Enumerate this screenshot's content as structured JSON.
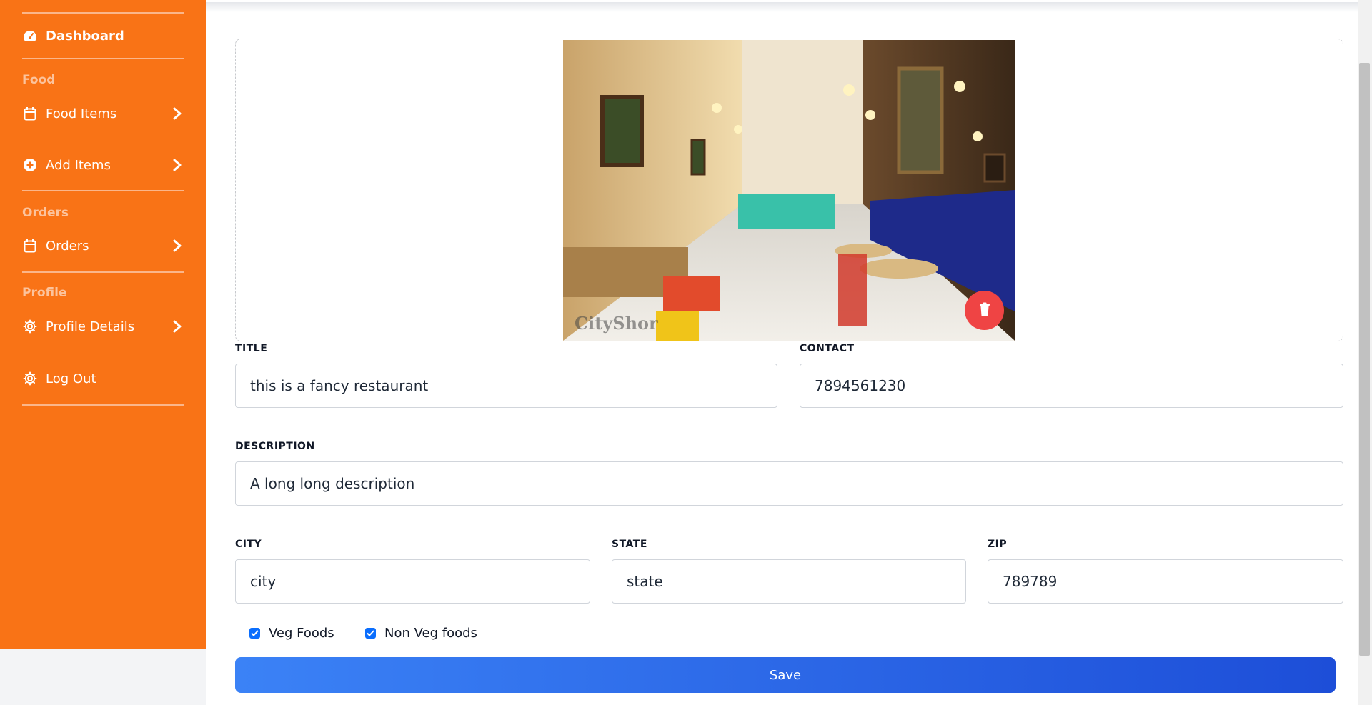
{
  "sidebar": {
    "dashboard": "Dashboard",
    "sections": {
      "food": "Food",
      "orders": "Orders",
      "profile": "Profile"
    },
    "items": {
      "food_items": "Food Items",
      "add_items": "Add Items",
      "orders": "Orders",
      "profile_details": "Profile Details",
      "logout": "Log Out"
    }
  },
  "image": {
    "watermark": "CityShor"
  },
  "form": {
    "title": {
      "label": "TITLE",
      "value": "this is a fancy restaurant"
    },
    "contact": {
      "label": "CONTACT",
      "value": "7894561230"
    },
    "description": {
      "label": "DESCRIPTION",
      "value": "A long long description"
    },
    "city": {
      "label": "CITY",
      "value": "city"
    },
    "state": {
      "label": "STATE",
      "value": "state"
    },
    "zip": {
      "label": "ZIP",
      "value": "789789"
    },
    "veg": {
      "label": "Veg Foods",
      "checked": true
    },
    "nonveg": {
      "label": "Non Veg foods",
      "checked": true
    },
    "save": "Save"
  },
  "colors": {
    "sidebar": "#f97316",
    "primary": "#2563eb",
    "danger": "#ef4444"
  }
}
